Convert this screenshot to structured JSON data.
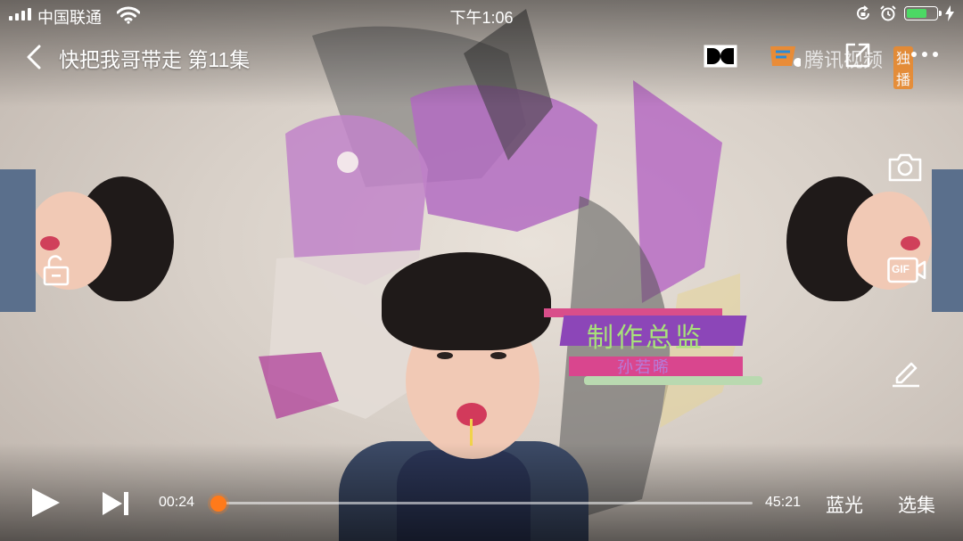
{
  "status_bar": {
    "carrier": "中国联通",
    "time": "下午1:06",
    "battery_level": 0.7
  },
  "top_bar": {
    "title": "快把我哥带走 第11集",
    "logo_text": "腾讯视频",
    "logo_badge": "独播"
  },
  "video_overlay": {
    "credit_role": "制作总监",
    "credit_name": "孙若晞"
  },
  "side_controls": {
    "lock": "lock-icon",
    "camera": "camera-icon",
    "gif_label": "GIF",
    "edit": "pencil-icon"
  },
  "player": {
    "current_time": "00:24",
    "total_time": "45:21",
    "progress": 0.009,
    "quality_label": "蓝光",
    "episodes_label": "选集"
  },
  "colors": {
    "accent": "#ff7a1a",
    "battery_fill": "#4cd964"
  }
}
